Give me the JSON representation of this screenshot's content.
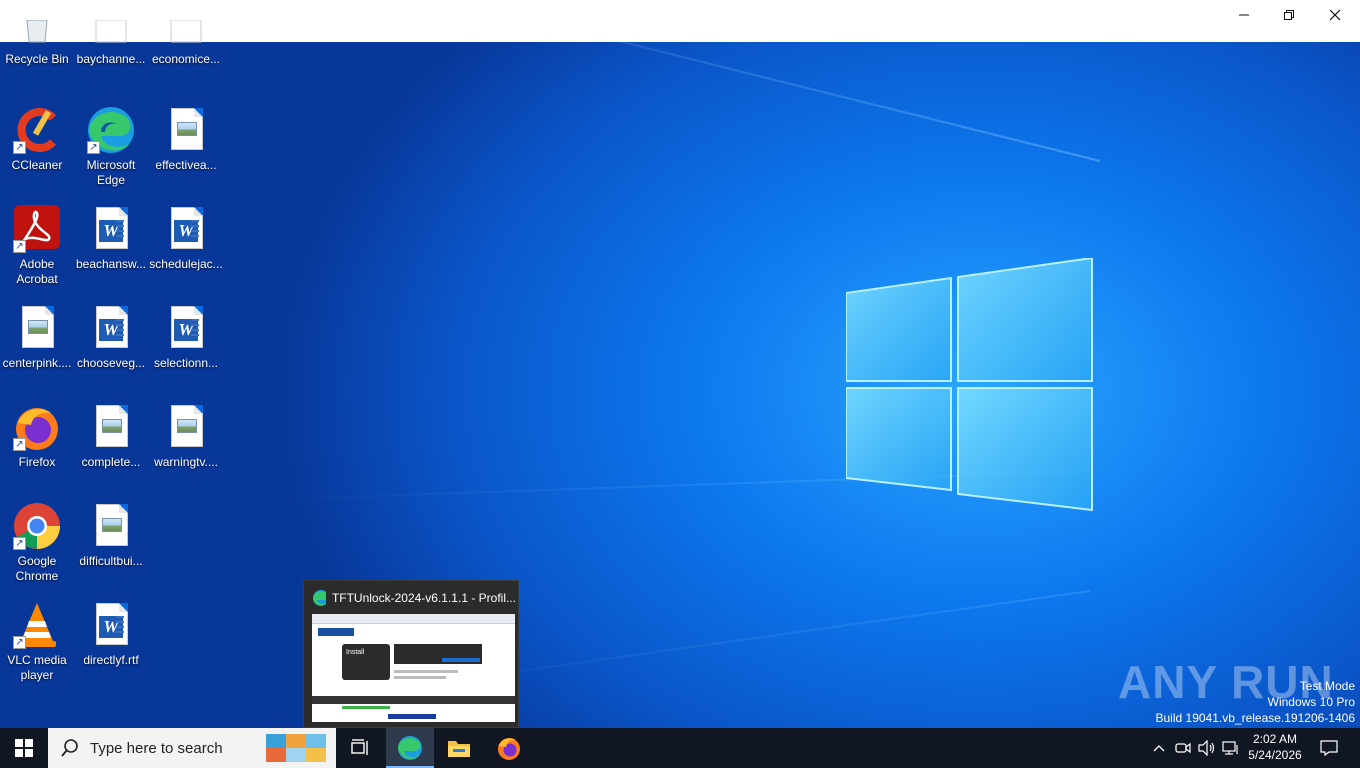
{
  "window": {
    "minimize_icon": "minimize-icon",
    "restore_icon": "restore-icon",
    "close_icon": "close-icon"
  },
  "desktop_icons": [
    {
      "label": "Recycle Bin",
      "icon": "recycle-bin-icon"
    },
    {
      "label": "baychanne...",
      "icon": "document-icon"
    },
    {
      "label": "economice...",
      "icon": "document-icon"
    },
    {
      "label": "CCleaner",
      "icon": "ccleaner-icon"
    },
    {
      "label": "Microsoft Edge",
      "icon": "edge-icon"
    },
    {
      "label": "effectivea...",
      "icon": "image-file-icon"
    },
    {
      "label": "Adobe Acrobat",
      "icon": "acrobat-icon"
    },
    {
      "label": "beachansw...",
      "icon": "word-doc-icon"
    },
    {
      "label": "schedulejac...",
      "icon": "word-doc-icon"
    },
    {
      "label": "centerpink....",
      "icon": "image-file-icon"
    },
    {
      "label": "chooseveg...",
      "icon": "word-doc-icon"
    },
    {
      "label": "selectionn...",
      "icon": "word-doc-icon"
    },
    {
      "label": "Firefox",
      "icon": "firefox-icon"
    },
    {
      "label": "complete...",
      "icon": "image-file-icon"
    },
    {
      "label": "warningtv....",
      "icon": "image-file-icon"
    },
    {
      "label": "Google Chrome",
      "icon": "chrome-icon"
    },
    {
      "label": "difficultbui...",
      "icon": "image-file-icon"
    },
    {
      "label": "VLC media player",
      "icon": "vlc-icon"
    },
    {
      "label": "directlyf.rtf",
      "icon": "word-doc-icon"
    }
  ],
  "preview": {
    "title": "TFTUnlock-2024-v6.1.1.1 - Profil...",
    "thumb_install": "Install"
  },
  "watermark": {
    "brand": "ANY RUN",
    "mode": "Test Mode",
    "os": "Windows 10 Pro",
    "build": "Build 19041.vb_release.191206-1406"
  },
  "taskbar": {
    "search_placeholder": "Type here to search",
    "time": "2:02 AM",
    "date": "5/24/2026"
  },
  "colors": {
    "taskbar": "#101622",
    "desktop_accent": "#0d79ef",
    "logo_glow": "#6fd8ff"
  }
}
